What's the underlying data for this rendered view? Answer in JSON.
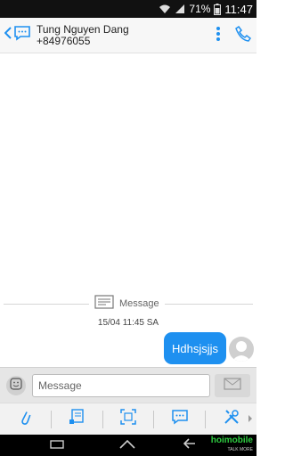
{
  "status_bar": {
    "battery_percent": "71%",
    "time": "11:47",
    "icons": [
      "wifi-icon",
      "signal-icon",
      "battery-icon"
    ]
  },
  "header": {
    "contact_name": "Tung Nguyen Dang",
    "contact_phone": "+84976055",
    "icons": [
      "back-chevron-icon",
      "conversation-icon",
      "overflow-menu-icon",
      "call-icon"
    ]
  },
  "conversation": {
    "divider_label": "Message",
    "timestamp": "15/04 11:45 SA",
    "messages": [
      {
        "text": "Hdhsjsjjs",
        "direction": "outgoing"
      }
    ]
  },
  "composer": {
    "placeholder": "Message",
    "value": ""
  },
  "toolbar": {
    "tools": [
      "attach-icon",
      "template-icon",
      "expand-icon",
      "quick-reply-icon",
      "settings-tools-icon"
    ]
  },
  "navbar": {
    "brand": "hoimobile",
    "brand_sub": "TALK MORE"
  },
  "colors": {
    "accent": "#1e90f0",
    "status_bar": "#111111",
    "header_bg": "#f7f7f7",
    "composer_bg": "#e6e6e6",
    "brand": "#2ecc40"
  }
}
